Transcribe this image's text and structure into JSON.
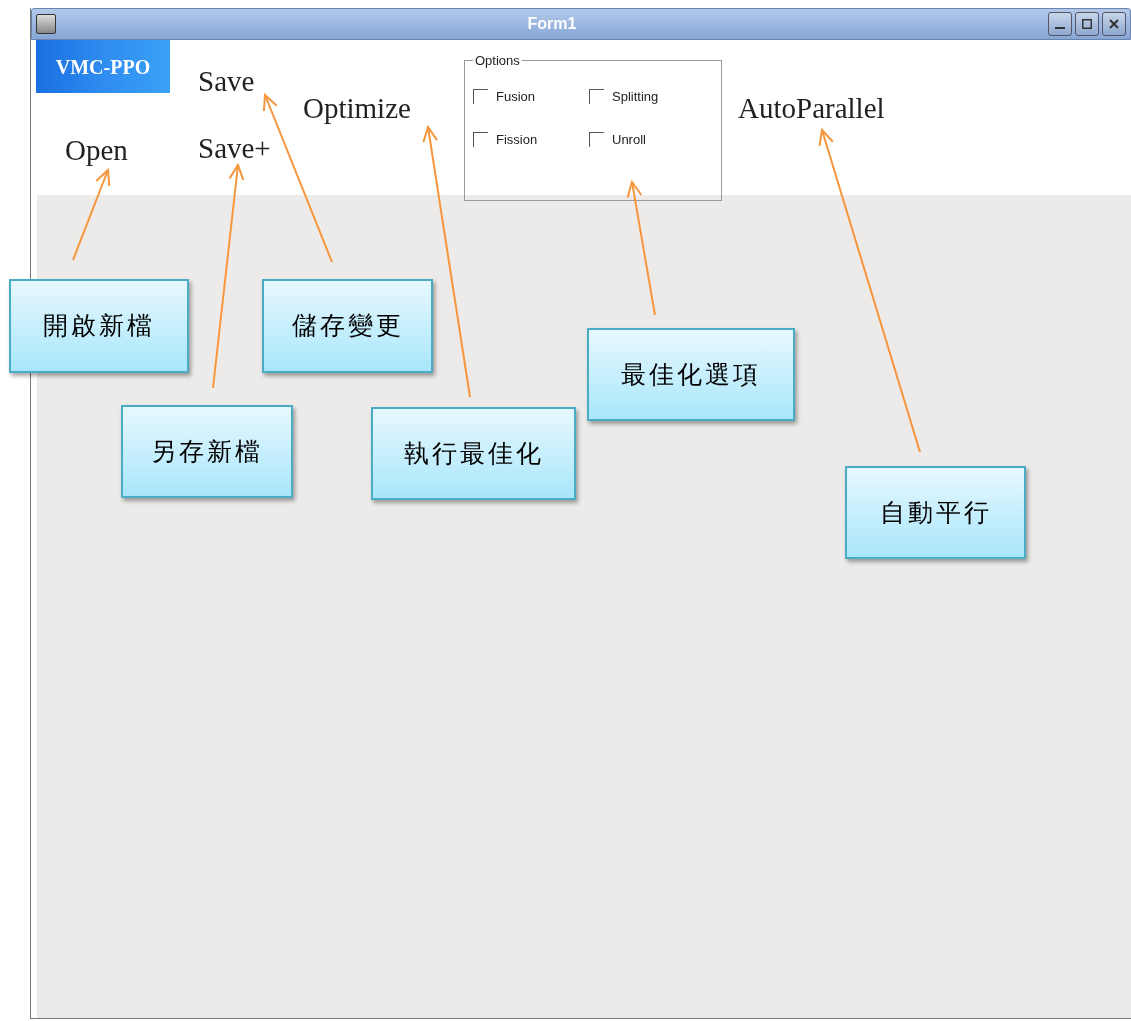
{
  "window": {
    "title": "Form1"
  },
  "logo": {
    "text": "VMC-PPO"
  },
  "toolbar": [
    {
      "label": "Save"
    },
    {
      "label": "Open"
    },
    {
      "label": "Save+"
    },
    {
      "label": "Optimize"
    },
    {
      "label": "AutoParallel"
    }
  ],
  "options": {
    "title": "Options",
    "checkboxes": [
      {
        "label": "Fusion",
        "checked": false
      },
      {
        "label": "Splitting",
        "checked": false
      },
      {
        "label": "Fission",
        "checked": false
      },
      {
        "label": "Unroll",
        "checked": false
      }
    ]
  },
  "annotations": [
    {
      "text": "開啟新檔"
    },
    {
      "text": "儲存變更"
    },
    {
      "text": "另存新檔"
    },
    {
      "text": "執行最佳化"
    },
    {
      "text": "最佳化選項"
    },
    {
      "text": "自動平行"
    }
  ]
}
